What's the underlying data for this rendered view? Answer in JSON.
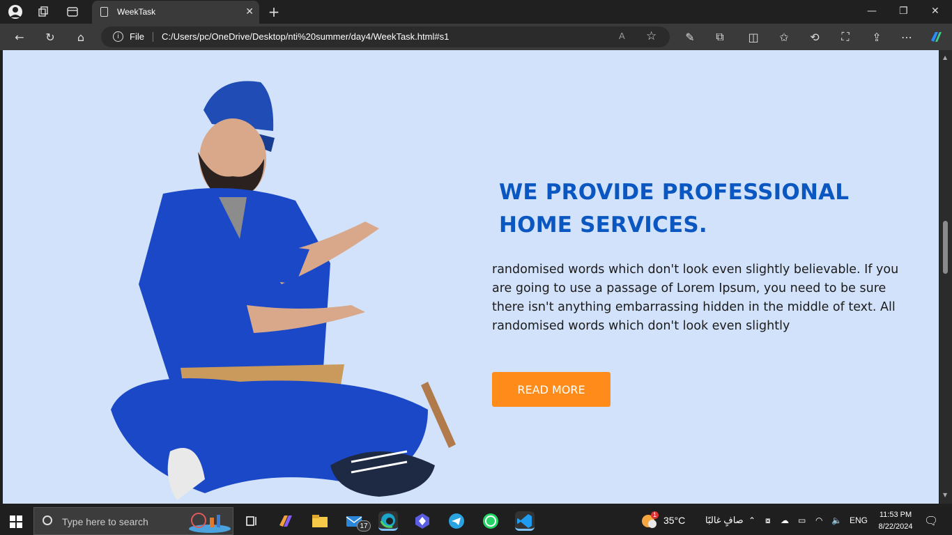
{
  "browser": {
    "tab_title": "WeekTask",
    "address_prefix": "File",
    "url": "C:/Users/pc/OneDrive/Desktop/nti%20summer/day4/WeekTask.html#s1",
    "read_aloud": "A"
  },
  "page": {
    "headline": "WE PROVIDE PROFESSIONAL HOME SERVICES.",
    "body": "randomised words which don't look even slightly believable. If you are going to use a passage of Lorem Ipsum, you need to be sure there isn't anything embarrassing hidden in the middle of text. All randomised words which don't look even slightly",
    "cta_label": "READ MORE",
    "colors": {
      "background": "#d2e2fa",
      "headline": "#0a57c2",
      "cta": "#ff8c1a"
    }
  },
  "taskbar": {
    "search_placeholder": "Type here to search",
    "mail_badge": "17",
    "weather_temp": "35°C",
    "weather_text": "صافٍ غالبًا",
    "weather_badge": "1",
    "language": "ENG",
    "time": "11:53 PM",
    "date": "8/22/2024"
  }
}
